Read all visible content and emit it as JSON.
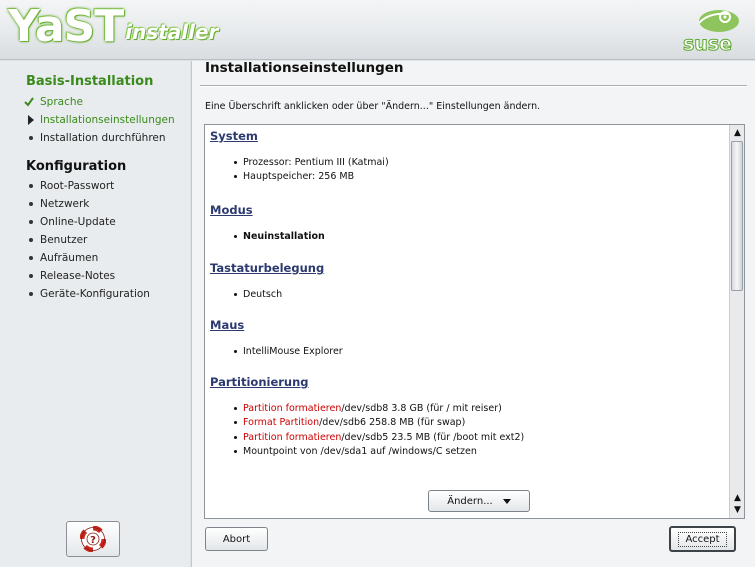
{
  "banner": {
    "logo_main": "YaST",
    "logo_sub": "installer",
    "brand_logo": "suse-logo"
  },
  "sidebar": {
    "section1_title": "Basis-Installation",
    "section1_items": [
      {
        "label": "Sprache",
        "state": "done",
        "icon": "checkmark-icon"
      },
      {
        "label": "Installationseinstellungen",
        "state": "current",
        "icon": "arrow-right-icon"
      },
      {
        "label": "Installation durchführen",
        "state": "todo",
        "icon": "bullet-icon"
      }
    ],
    "section2_title": "Konfiguration",
    "section2_items": [
      {
        "label": "Root-Passwort"
      },
      {
        "label": "Netzwerk"
      },
      {
        "label": "Online-Update"
      },
      {
        "label": "Benutzer"
      },
      {
        "label": "Aufräumen"
      },
      {
        "label": "Release-Notes"
      },
      {
        "label": "Geräte-Konfiguration"
      }
    ],
    "help_icon": "help-lifebuoy-icon"
  },
  "main": {
    "title": "Installationseinstellungen",
    "intro": "Eine Überschrift anklicken oder über \"Ändern...\" Einstellungen ändern.",
    "sections": [
      {
        "heading": "System",
        "items": [
          {
            "text": "Prozessor: Pentium III (Katmai)"
          },
          {
            "text": "Hauptspeicher: 256 MB"
          }
        ]
      },
      {
        "heading": "Modus",
        "items": [
          {
            "text": "Neuinstallation",
            "bold": true
          }
        ]
      },
      {
        "heading": "Tastaturbelegung",
        "items": [
          {
            "text": "Deutsch"
          }
        ]
      },
      {
        "heading": "Maus",
        "items": [
          {
            "text": "IntelliMouse Explorer"
          }
        ]
      },
      {
        "heading": "Partitionierung",
        "items": [
          {
            "red": "Partition formatieren",
            "text": " /dev/sdb8 3.8 GB (für / mit reiser)"
          },
          {
            "red": "Format Partition",
            "text": " /dev/sdb6 258.8 MB (für swap)"
          },
          {
            "red": "Partition formatieren",
            "text": " /dev/sdb5 23.5 MB (für /boot mit ext2)"
          },
          {
            "text": "Mountpoint von /dev/sda1 auf /windows/C setzen"
          }
        ]
      }
    ],
    "change_button": "Ändern...",
    "abort_button": "Abort",
    "accept_button": "Accept"
  },
  "colors": {
    "accent_green": "#3a8a1c",
    "link_blue": "#2c3a70",
    "warning_red": "#cc0000"
  }
}
